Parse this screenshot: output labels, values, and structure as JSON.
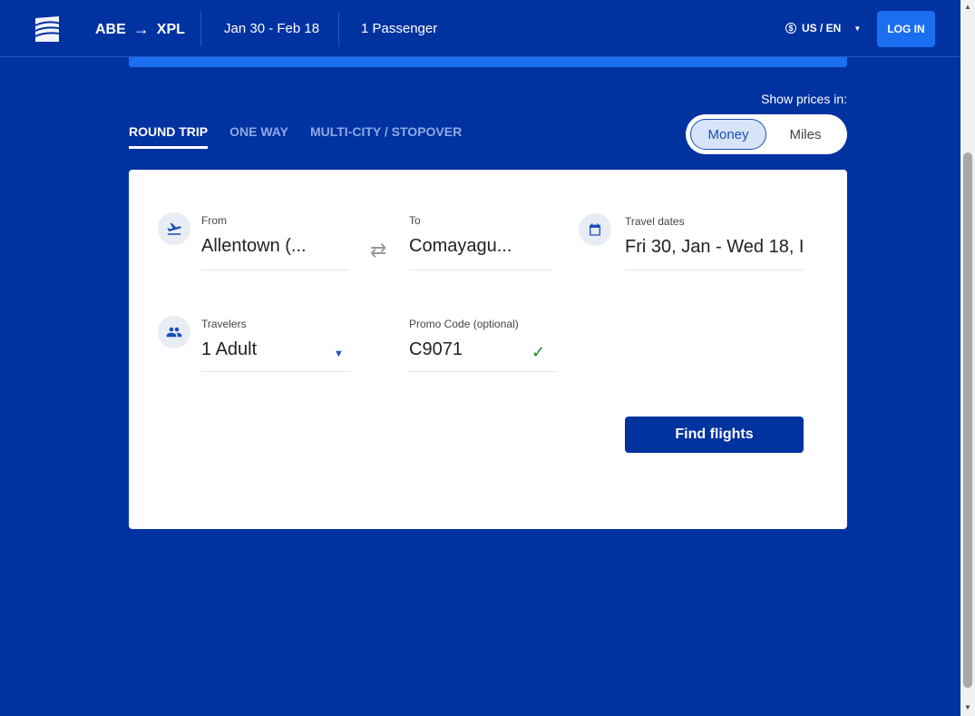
{
  "header": {
    "origin": "ABE",
    "destination": "XPL",
    "dates": "Jan 30 - Feb 18",
    "passengers": "1 Passenger",
    "locale": "US / EN",
    "login_label": "LOG IN"
  },
  "prices": {
    "label": "Show prices in:",
    "money": "Money",
    "miles": "Miles",
    "selected": "Money"
  },
  "tabs": [
    {
      "label": "ROUND TRIP",
      "active": true
    },
    {
      "label": "ONE WAY",
      "active": false
    },
    {
      "label": "MULTI-CITY / STOPOVER",
      "active": false
    }
  ],
  "form": {
    "from_label": "From",
    "from_value": "Allentown (...",
    "to_label": "To",
    "to_value": "Comayagu...",
    "dates_label": "Travel dates",
    "dates_value": "Fri 30, Jan - Wed 18, I",
    "travelers_label": "Travelers",
    "travelers_value": "1 Adult",
    "promo_label": "Promo Code (optional)",
    "promo_value": "C9071",
    "find_label": "Find flights"
  },
  "colors": {
    "brand": "#0032a0",
    "accent": "#1a6ff0",
    "success": "#1a8a2a"
  }
}
